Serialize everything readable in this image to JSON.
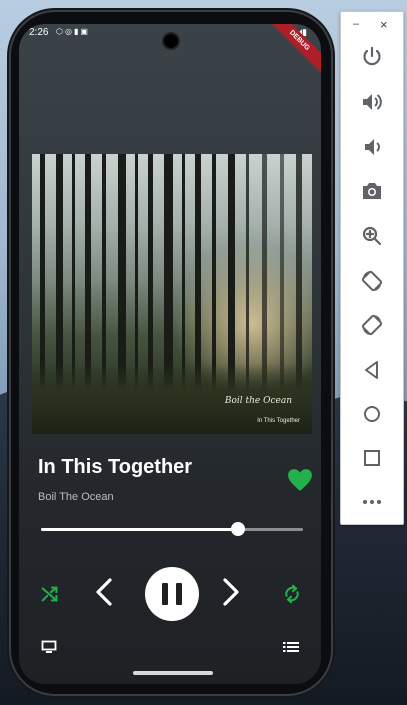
{
  "status_bar": {
    "time": "2:26",
    "left_icons": [
      "shield-icon",
      "sync-icon",
      "sim-icon",
      "notification-icon"
    ],
    "right_icons": [
      "wifi-icon",
      "signal-icon",
      "battery-icon"
    ]
  },
  "debug_banner": "DEBUG",
  "album_art": {
    "signature": "Boil the Ocean",
    "caption": "In This Together"
  },
  "track": {
    "title": "In This Together",
    "artist": "Boil The Ocean",
    "favorited": true,
    "progress_fraction": 0.75
  },
  "controls": {
    "shuffle": "shuffle-icon",
    "previous": "chevron-left-icon",
    "play_state": "pause-icon",
    "next": "chevron-right-icon",
    "repeat": "repeat-icon",
    "cast": "cast-icon",
    "queue": "queue-icon"
  },
  "colors": {
    "accent": "#22b14c",
    "title": "#ffffff",
    "artist": "#b9bdc0"
  },
  "emulator_toolbar": {
    "minimize": "–",
    "close": "×",
    "buttons": [
      "power-icon",
      "volume-up-icon",
      "volume-down-icon",
      "camera-icon",
      "zoom-icon",
      "rotate-left-icon",
      "rotate-right-icon",
      "back-icon",
      "home-icon",
      "overview-icon",
      "more-icon"
    ]
  }
}
